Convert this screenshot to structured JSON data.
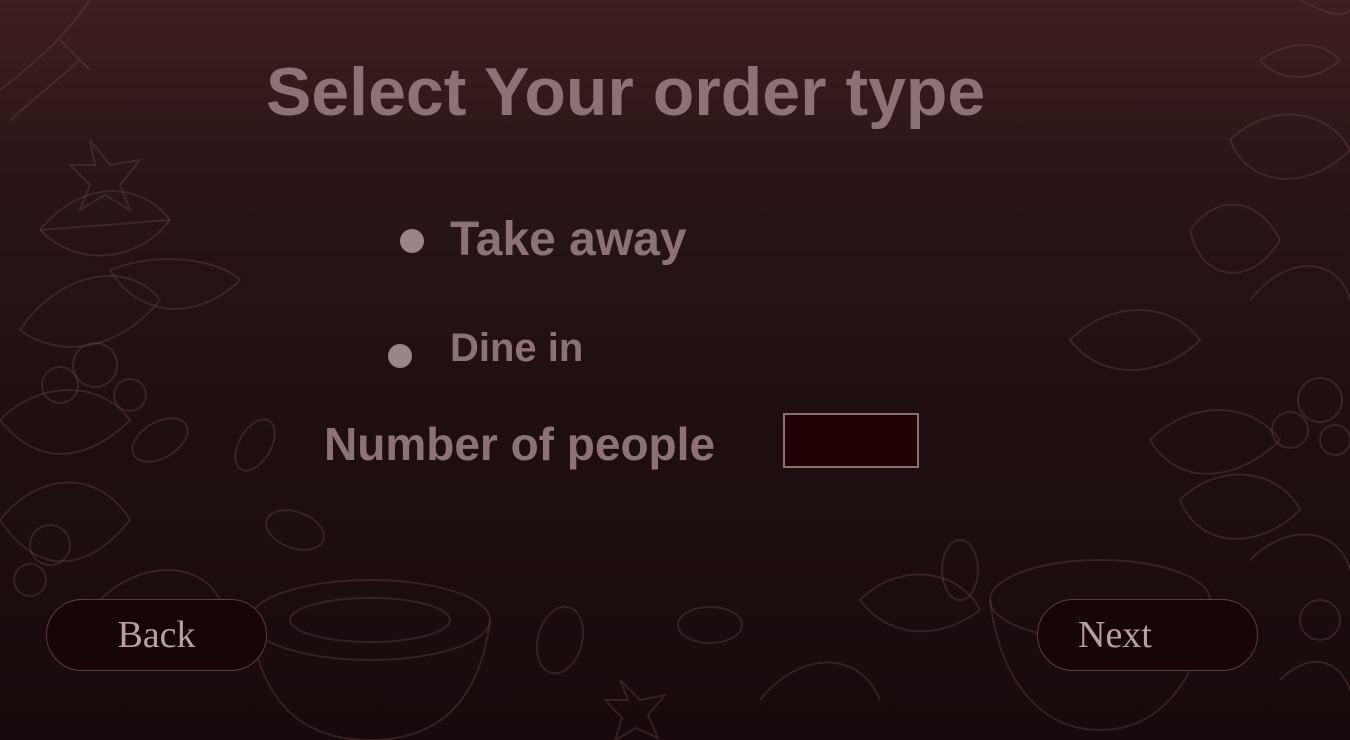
{
  "page": {
    "title": "Select Your order type"
  },
  "order_types": [
    {
      "label": "Take away"
    },
    {
      "label": "Dine in"
    }
  ],
  "people": {
    "label": "Number of people",
    "value": "",
    "placeholder": ""
  },
  "nav": {
    "back_label": "Back",
    "next_label": "Next"
  },
  "colors": {
    "background_top": "#3e1e1e",
    "background_bottom": "#180a0c",
    "text": "#8c7275",
    "input_fill": "#220204",
    "button_fill": "#170607"
  }
}
